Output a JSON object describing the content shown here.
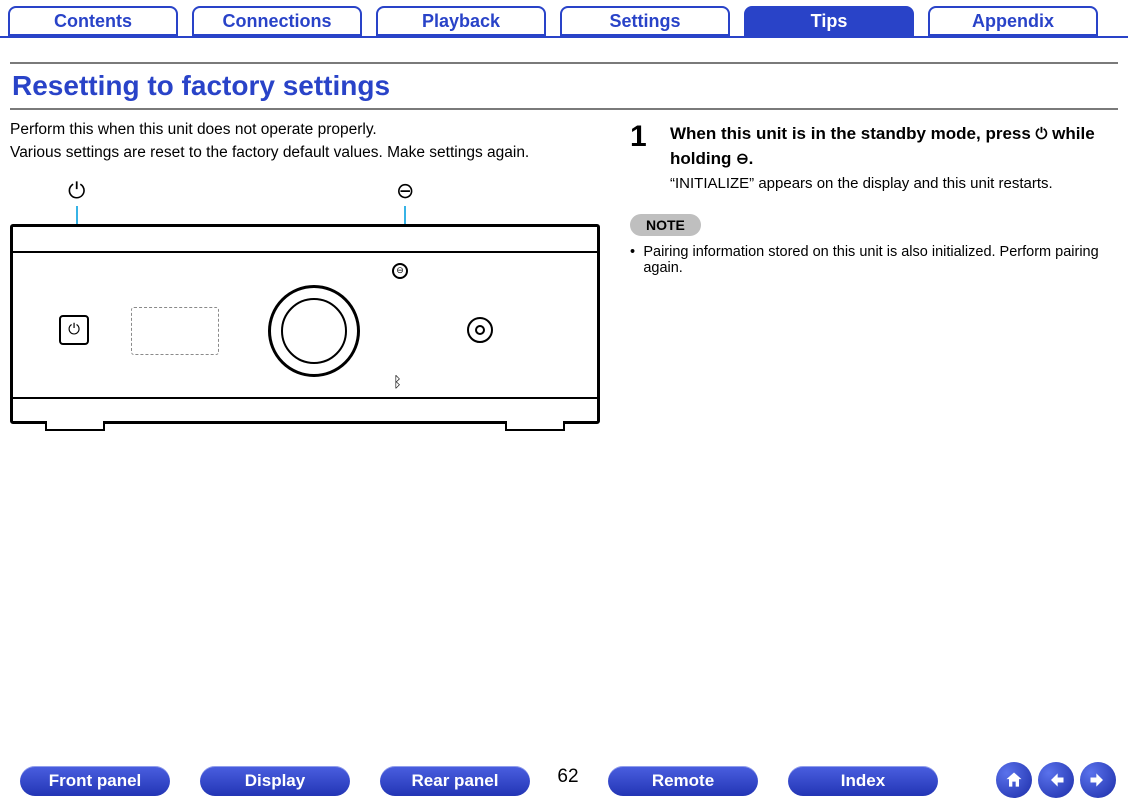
{
  "nav": {
    "tabs": [
      {
        "label": "Contents",
        "active": false
      },
      {
        "label": "Connections",
        "active": false
      },
      {
        "label": "Playback",
        "active": false
      },
      {
        "label": "Settings",
        "active": false
      },
      {
        "label": "Tips",
        "active": true
      },
      {
        "label": "Appendix",
        "active": false
      }
    ]
  },
  "title": "Resetting to factory settings",
  "intro": {
    "line1": "Perform this when this unit does not operate properly.",
    "line2": "Various settings are reset to the factory default values. Make settings again."
  },
  "callout_icons": {
    "power": "⏻",
    "input": "⊖"
  },
  "step": {
    "num": "1",
    "head_part1": "When this unit is in the standby mode, press ",
    "head_icon1": "⏻",
    "head_part2": " while holding ",
    "head_icon2": "⊖",
    "head_part3": ".",
    "sub": "“INITIALIZE” appears on the display and this unit restarts."
  },
  "note": {
    "label": "NOTE",
    "bullet": "•",
    "text": "Pairing information stored on this unit is also initialized. Perform pairing again."
  },
  "bottom": {
    "pills": [
      "Front panel",
      "Display",
      "Rear panel",
      "Remote",
      "Index"
    ],
    "page": "62",
    "icons": {
      "home": "home-icon",
      "prev": "arrow-left-icon",
      "next": "arrow-right-icon"
    }
  }
}
